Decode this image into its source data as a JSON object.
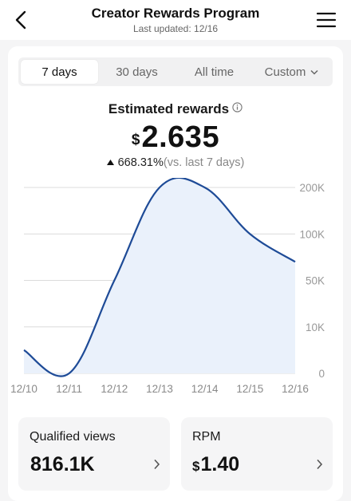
{
  "header": {
    "title": "Creator Rewards Program",
    "subtitle": "Last updated: 12/16",
    "back_icon": "chevron-left-icon",
    "menu_icon": "hamburger-menu-icon"
  },
  "tabs": [
    {
      "label": "7 days",
      "active": true
    },
    {
      "label": "30 days",
      "active": false
    },
    {
      "label": "All time",
      "active": false
    },
    {
      "label": "Custom",
      "active": false,
      "icon": "chevron-down-icon"
    }
  ],
  "rewards": {
    "label": "Estimated rewards",
    "currency": "$",
    "amount": "2.635",
    "change": "668.31%",
    "comparison": "(vs. last 7 days)",
    "trend_icon": "triangle-up-icon"
  },
  "colors": {
    "line": "#1e4b97",
    "fill": "#eaf1fb",
    "accent": "#111111"
  },
  "chart_data": {
    "type": "area",
    "x": [
      "12/10",
      "12/11",
      "12/12",
      "12/13",
      "12/14",
      "12/15",
      "12/16"
    ],
    "y_ticks": [
      "0",
      "10K",
      "50K",
      "100K",
      "200K"
    ],
    "ylabel": "",
    "xlabel": "",
    "grid": true,
    "series": [
      {
        "values": [
          {
            "x": "12/10",
            "y": 5
          },
          {
            "x": "12/11",
            "y": 0
          },
          {
            "x": "12/12",
            "y": 50
          },
          {
            "x": "12/13",
            "y": 200
          },
          {
            "x": "12/14",
            "y": 200
          },
          {
            "x": "12/15",
            "y": 100
          },
          {
            "x": "12/16",
            "y": 70
          }
        ]
      }
    ]
  },
  "metrics": [
    {
      "label": "Qualified views",
      "value": "816.1K",
      "currency": ""
    },
    {
      "label": "RPM",
      "value": "1.40",
      "currency": "$"
    }
  ]
}
